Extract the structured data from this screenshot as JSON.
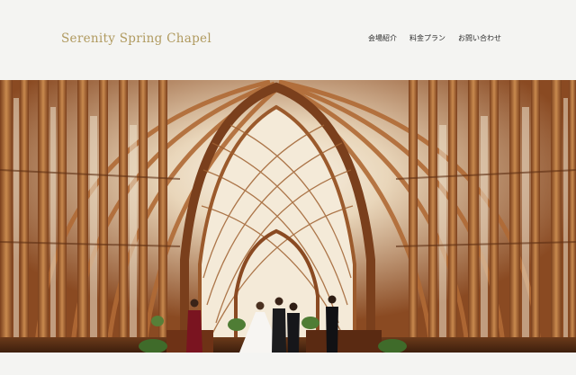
{
  "site": {
    "title": "Serenity Spring Chapel"
  },
  "nav": {
    "items": [
      {
        "label": "会場紹介"
      },
      {
        "label": "料金プラン"
      },
      {
        "label": "お問い合わせ"
      }
    ]
  },
  "hero": {
    "image": "wedding-ceremony-in-wooden-glass-chapel"
  },
  "colors": {
    "brand": "#b09a5f",
    "background": "#f4f4f2",
    "wood": "#b06a35"
  }
}
